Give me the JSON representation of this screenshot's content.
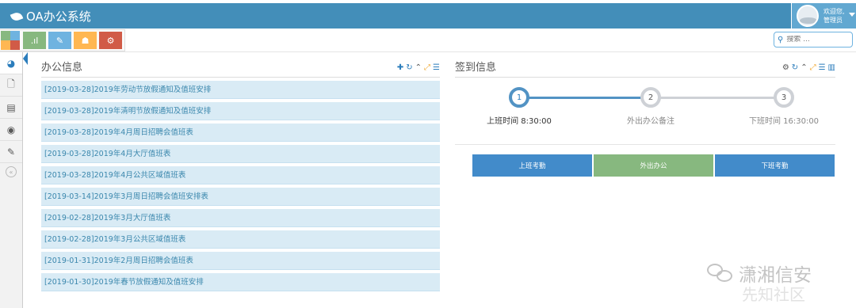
{
  "header": {
    "app_title": "OA办公系统",
    "logo_icon": "leaf-icon",
    "bg_color": "#438eb9",
    "user": {
      "greeting": "欢迎您,",
      "name": "管理员"
    }
  },
  "shortcuts": {
    "buttons": [
      {
        "icon": "signal-icon",
        "glyph": ".ıl",
        "color": "#87b87f"
      },
      {
        "icon": "pencil-icon",
        "glyph": "✎",
        "color": "#6fb3e0"
      },
      {
        "icon": "users-icon",
        "glyph": "☗",
        "color": "#ffb752"
      },
      {
        "icon": "cogs-icon",
        "glyph": "⚙",
        "color": "#d15b47"
      }
    ],
    "grid_colors": [
      "#87b87f",
      "#6fb3e0",
      "#ffb752",
      "#d15b47"
    ]
  },
  "search": {
    "placeholder": "搜索 ..."
  },
  "sidebar": {
    "items": [
      {
        "icon": "dashboard-icon",
        "glyph": "◕"
      },
      {
        "icon": "file-icon",
        "glyph": "🗋"
      },
      {
        "icon": "list-icon",
        "glyph": "▤"
      },
      {
        "icon": "eye-icon",
        "glyph": "◉"
      },
      {
        "icon": "edit-icon",
        "glyph": "✎"
      }
    ],
    "collapse_glyph": "«"
  },
  "office_info": {
    "title": "办公信息",
    "items": [
      "[2019-03-28]2019年劳动节放假通知及值班安排",
      "[2019-03-28]2019年清明节放假通知及值班安排",
      "[2019-03-28]2019年4月周日招聘会值班表",
      "[2019-03-28]2019年4月大厅值班表",
      "[2019-03-28]2019年4月公共区域值班表",
      "[2019-03-14]2019年3月周日招聘会值班安排表",
      "[2019-02-28]2019年3月大厅值班表",
      "[2019-02-28]2019年3月公共区域值班表",
      "[2019-01-31]2019年2月周日招聘会值班表",
      "[2019-01-30]2019年春节放假通知及值班安排"
    ]
  },
  "sign_info": {
    "title": "签到信息",
    "steps": [
      {
        "num": "1",
        "label": "上班时间 8:30:00"
      },
      {
        "num": "2",
        "label": "外出办公备注"
      },
      {
        "num": "3",
        "label": "下班时间 16:30:00"
      }
    ],
    "progress": 0.5,
    "buttons": [
      {
        "label": "上班考勤",
        "color": "#428bca"
      },
      {
        "label": "外出办公",
        "color": "#87b87f"
      },
      {
        "label": "下班考勤",
        "color": "#428bca"
      }
    ]
  },
  "watermark": {
    "text": "潇湘信安",
    "sub": "先知社区"
  }
}
